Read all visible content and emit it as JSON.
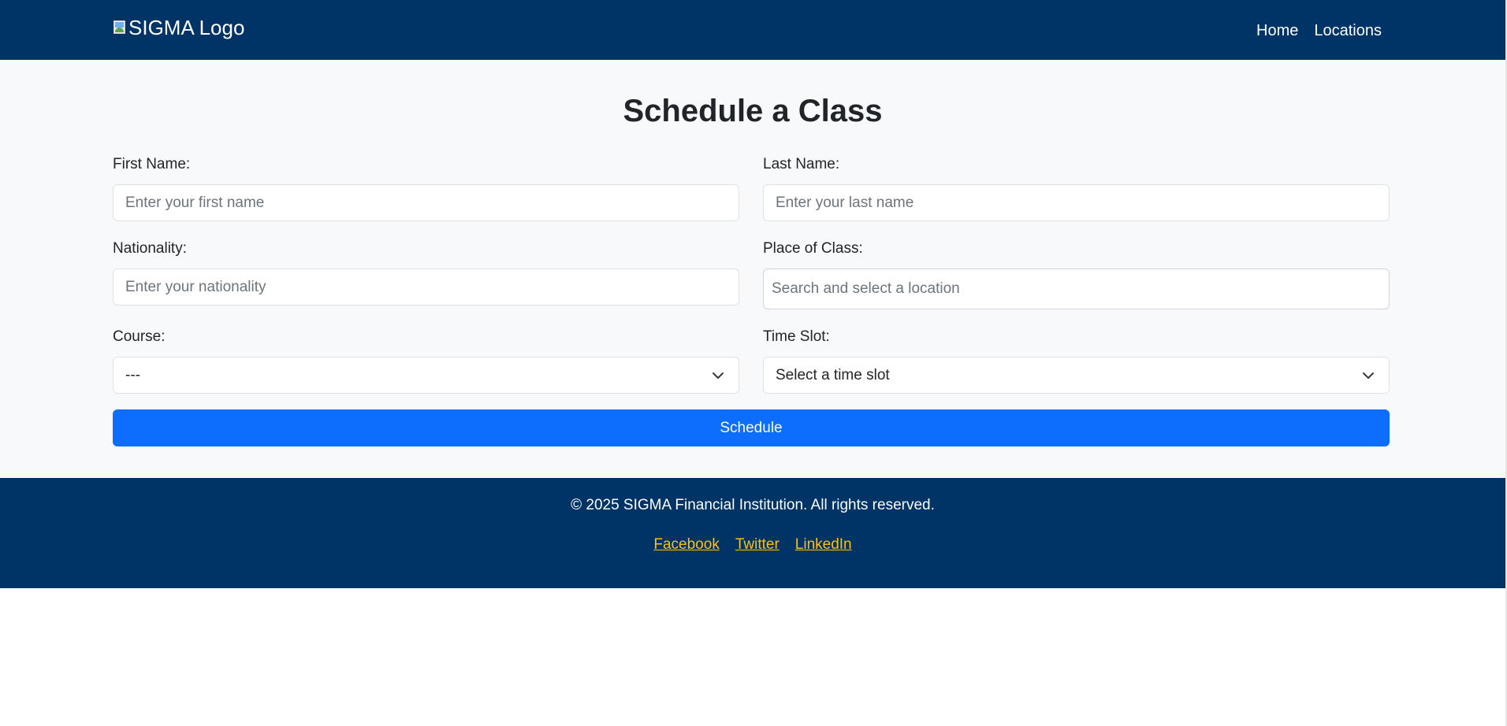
{
  "header": {
    "logo_alt": "SIGMA Logo",
    "nav": [
      {
        "label": "Home"
      },
      {
        "label": "Locations"
      }
    ]
  },
  "page": {
    "title": "Schedule a Class"
  },
  "form": {
    "first_name": {
      "label": "First Name:",
      "placeholder": "Enter your first name"
    },
    "last_name": {
      "label": "Last Name:",
      "placeholder": "Enter your last name"
    },
    "nationality": {
      "label": "Nationality:",
      "placeholder": "Enter your nationality"
    },
    "place": {
      "label": "Place of Class:",
      "placeholder": "Search and select a location"
    },
    "course": {
      "label": "Course:",
      "selected": "---"
    },
    "time_slot": {
      "label": "Time Slot:",
      "selected": "Select a time slot"
    },
    "submit_label": "Schedule"
  },
  "footer": {
    "copyright": "© 2025 SIGMA Financial Institution. All rights reserved.",
    "links": [
      {
        "label": "Facebook"
      },
      {
        "label": "Twitter"
      },
      {
        "label": "LinkedIn"
      }
    ]
  },
  "colors": {
    "brand_navy": "#003366",
    "primary_button": "#0d6efd",
    "footer_link": "#ffc107",
    "page_background": "#f8f9fa"
  }
}
